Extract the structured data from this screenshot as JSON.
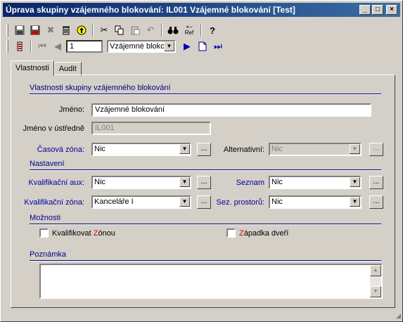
{
  "window": {
    "title": "Úprava skupiny vzájemného blokování: IL001 Vzájemné blokování [Test]",
    "minimize": "_",
    "maximize": "□",
    "close": "×"
  },
  "toolbar": {
    "record_number": "1",
    "record_selector": "Vzájemné blokov",
    "ref_label": "Ref"
  },
  "tabs": [
    {
      "label": "Vlastnosti",
      "active": true
    },
    {
      "label": "Audit",
      "active": false
    }
  ],
  "sections": {
    "properties": "Vlastnosti skupiny vzájemného blokování",
    "settings": "Nastavení",
    "options": "Možnosti",
    "note": "Poznámka"
  },
  "fields": {
    "name_label": "Jméno:",
    "name_value": "Vzájemné blokování",
    "panel_name_label": "Jméno v ústředně",
    "panel_name_value": "IL001",
    "time_zone_label": "Časová zóna:",
    "time_zone_value": "Nic",
    "alternative_label": "Alternativní:",
    "alternative_value": "Nic",
    "aux_label": "Kvalifikační aux:",
    "aux_value": "Nic",
    "list_label": "Seznam",
    "list_value": "Nic",
    "qzone_label": "Kvalifikační zóna:",
    "qzone_value": "Kanceláře I",
    "spaces_label": "Sez. prostorů:",
    "spaces_value": "Nic",
    "dots": "..."
  },
  "options": {
    "qualify_zone": {
      "prefix": "Kvalifikovat ",
      "accent": "Z",
      "suffix": "ónou",
      "checked": false
    },
    "door_latch": {
      "prefix": "",
      "accent": "Z",
      "suffix": "ápadka dveří",
      "checked": false
    }
  },
  "note": {
    "value": ""
  },
  "colors": {
    "title_gradient_start": "#0a246a",
    "title_gradient_end": "#3a6ea5",
    "face": "#d4d0c8",
    "section_text": "#000080",
    "label_blue": "#0000a0",
    "accent_red": "#e00000"
  }
}
